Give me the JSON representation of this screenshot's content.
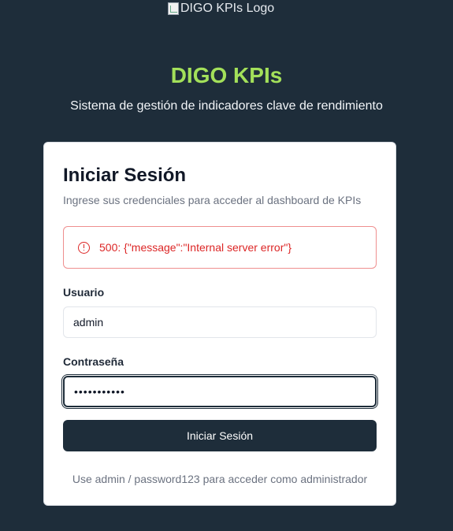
{
  "logo": {
    "alt": "DIGO KPIs Logo"
  },
  "brand": {
    "title": "DIGO KPIs",
    "subtitle": "Sistema de gestión de indicadores clave de rendimiento"
  },
  "login": {
    "title": "Iniciar Sesión",
    "description": "Ingrese sus credenciales para acceder al dashboard de KPIs",
    "error": {
      "icon": "alert-circle-icon",
      "message": "500: {\"message\":\"Internal server error\"}"
    },
    "username": {
      "label": "Usuario",
      "value": "admin"
    },
    "password": {
      "label": "Contraseña",
      "value": "•••••••••••"
    },
    "submit_label": "Iniciar Sesión",
    "hint": "Use admin / password123 para acceder como administrador"
  },
  "colors": {
    "background": "#1e2d3a",
    "brand_accent": "#a3e05a",
    "error": "#dc2626",
    "button": "#1e2d3a"
  }
}
